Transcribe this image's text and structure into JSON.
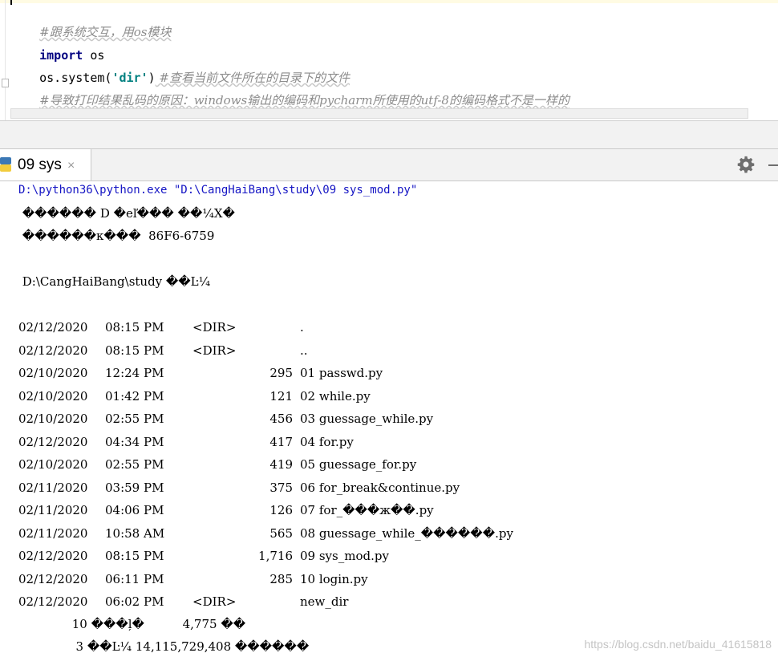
{
  "editor": {
    "line1_comment": "#跟系统交互，用os模块",
    "line2_keyword": "import",
    "line2_module": " os",
    "line3_call": "os.system(",
    "line3_string": "'dir'",
    "line3_close": ")",
    "line3_comment": " #查看当前文件所在的目录下的文件",
    "line4_comment": "#导致打印结果乱码的原因：windows输出的编码和pycharm所使用的utf-8的编码格式不是一样的"
  },
  "run_window": {
    "tab_label": "09 sys",
    "close_symbol": "×",
    "settings_icon": "gear-icon",
    "minimize_icon": "minimize-icon"
  },
  "console": {
    "command": "D:\\python36\\python.exe \"D:\\CangHaiBang\\study\\09 sys_mod.py\"",
    "garbled_1": " ������ D �еľ��� ��¼X�",
    "garbled_2": " ������к���  86F6-6759",
    "dir_header": " D:\\CangHaiBang\\study ��Ŀ¼",
    "rows": [
      {
        "date": "02/12/2020",
        "time": "08:15 PM",
        "dir": "<DIR>",
        "size": "",
        "name": "."
      },
      {
        "date": "02/12/2020",
        "time": "08:15 PM",
        "dir": "<DIR>",
        "size": "",
        "name": ".."
      },
      {
        "date": "02/10/2020",
        "time": "12:24 PM",
        "dir": "",
        "size": "295",
        "name": "01 passwd.py"
      },
      {
        "date": "02/10/2020",
        "time": "01:42 PM",
        "dir": "",
        "size": "121",
        "name": "02 while.py"
      },
      {
        "date": "02/10/2020",
        "time": "02:55 PM",
        "dir": "",
        "size": "456",
        "name": "03 guessage_while.py"
      },
      {
        "date": "02/12/2020",
        "time": "04:34 PM",
        "dir": "",
        "size": "417",
        "name": "04 for.py"
      },
      {
        "date": "02/10/2020",
        "time": "02:55 PM",
        "dir": "",
        "size": "419",
        "name": "05 guessage_for.py"
      },
      {
        "date": "02/11/2020",
        "time": "03:59 PM",
        "dir": "",
        "size": "375",
        "name": "06 for_break&continue.py"
      },
      {
        "date": "02/11/2020",
        "time": "04:06 PM",
        "dir": "",
        "size": "126",
        "name": "07 for_���ж��.py"
      },
      {
        "date": "02/11/2020",
        "time": "10:58 AM",
        "dir": "",
        "size": "565",
        "name": "08 guessage_while_������.py"
      },
      {
        "date": "02/12/2020",
        "time": "08:15 PM",
        "dir": "",
        "size": "1,716",
        "name": "09 sys_mod.py"
      },
      {
        "date": "02/12/2020",
        "time": "06:11 PM",
        "dir": "",
        "size": "285",
        "name": "10 login.py"
      },
      {
        "date": "02/12/2020",
        "time": "06:02 PM",
        "dir": "<DIR>",
        "size": "",
        "name": "new_dir"
      }
    ],
    "summary_1": "              10 ���ļ�          4,775 ��",
    "summary_2": "               3 ��Ŀ¼ 14,115,729,408 ������"
  },
  "watermark": "https://blog.csdn.net/baidu_41615818"
}
